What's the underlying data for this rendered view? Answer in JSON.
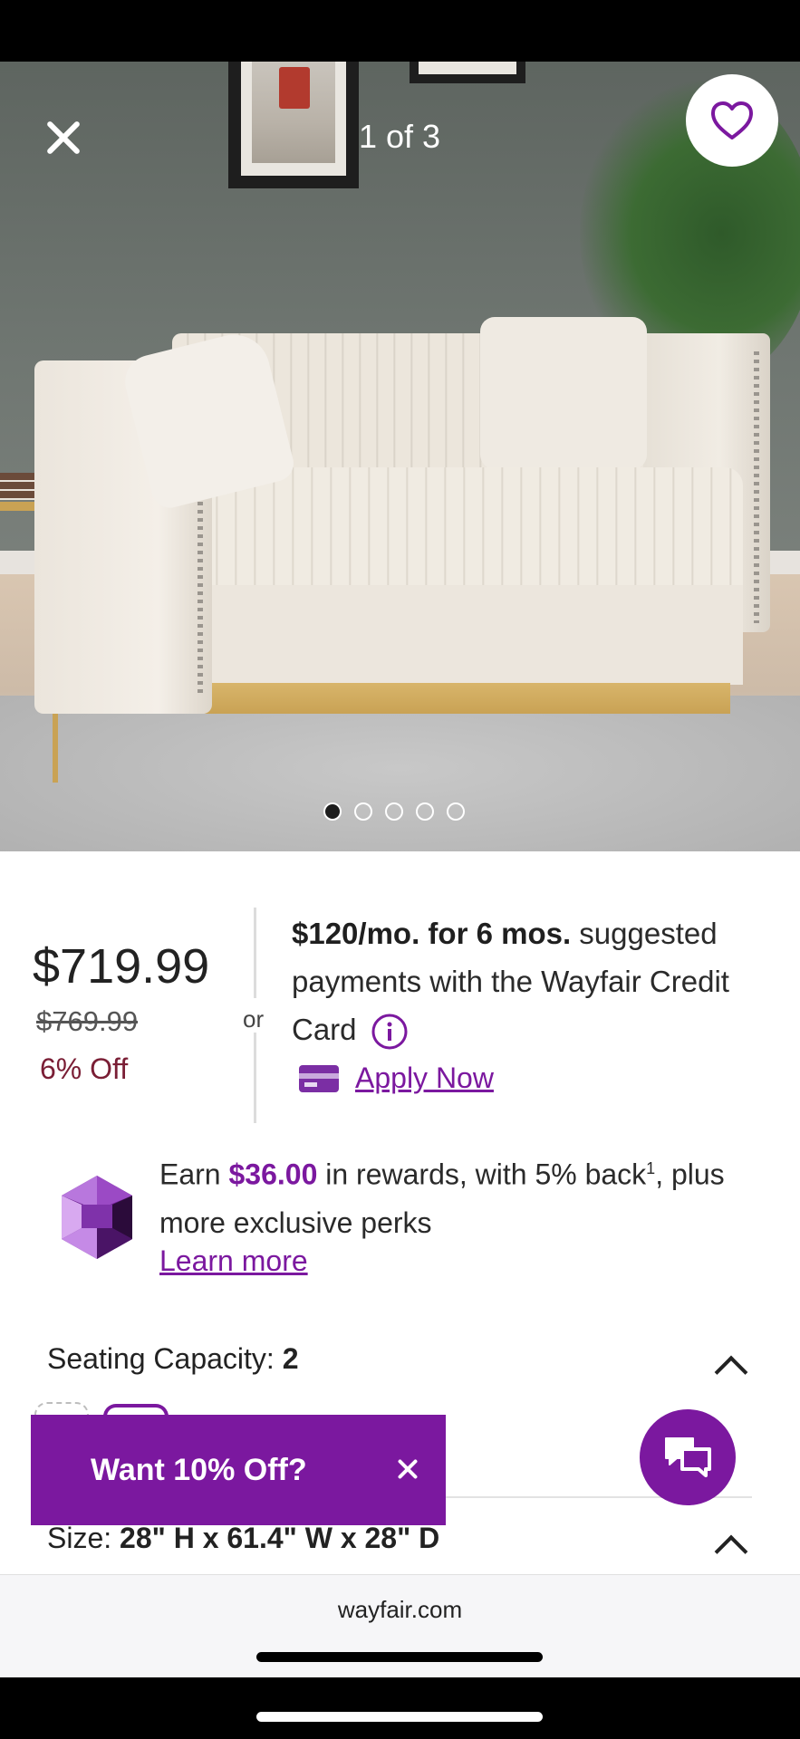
{
  "gallery": {
    "counter": "1 of 3",
    "dots": 5,
    "active_dot": 0
  },
  "price": {
    "current": "$719.99",
    "original": "$769.99",
    "discount": "6% Off"
  },
  "financing": {
    "separator": "or",
    "offer_bold": "$120/mo. for 6 mos.",
    "offer_rest": " suggested payments with the Wayfair Credit Card",
    "apply_label": "Apply Now"
  },
  "rewards": {
    "prefix": "Earn ",
    "amount": "$36.00",
    "middle": " in rewards, with 5% back",
    "footnote": "1",
    "suffix": ", plus more exclusive perks",
    "learn_more": "Learn more"
  },
  "options": {
    "seating_label": "Seating Capacity: ",
    "seating_value": "2",
    "size_label": "Size: ",
    "size_value": "28\" H x 61.4\" W x 28\" D"
  },
  "promo": {
    "text": "Want 10% Off?"
  },
  "browser": {
    "url": "wayfair.com"
  },
  "colors": {
    "brand_purple": "#7b189f",
    "discount_red": "#7a1e35"
  },
  "icons": [
    "close-icon",
    "heart-icon",
    "info-icon",
    "credit-card-icon",
    "rewards-gem-icon",
    "chevron-up-icon",
    "chat-icon"
  ]
}
